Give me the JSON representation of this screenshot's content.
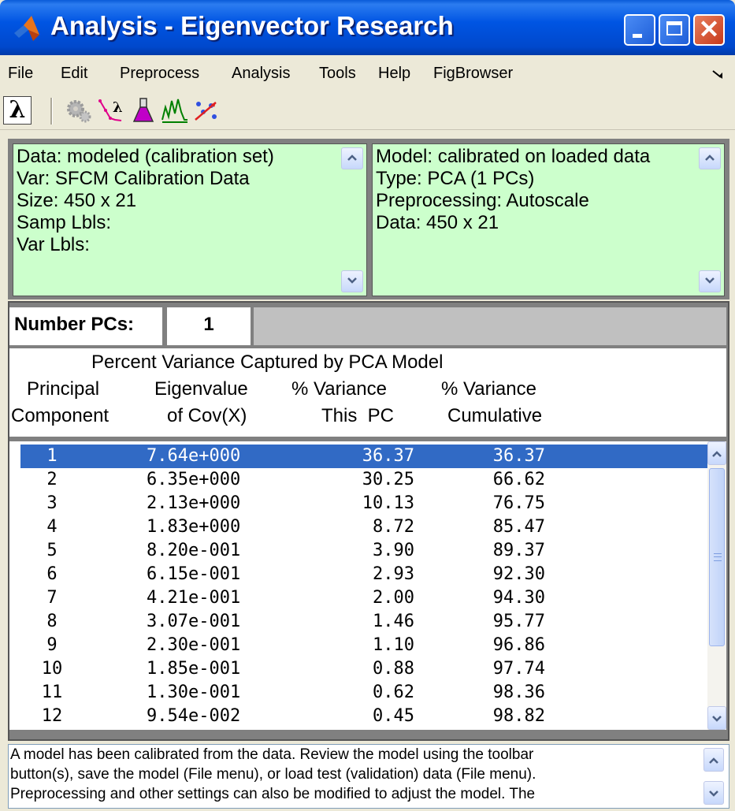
{
  "window": {
    "title": "Analysis - Eigenvector Research"
  },
  "menu": {
    "items": [
      "File",
      "Edit",
      "Preprocess",
      "Analysis",
      "Tools",
      "Help",
      "FigBrowser"
    ]
  },
  "toolbar": {
    "tools": [
      "lambda-icon",
      "gears-icon",
      "eigenvalue-plot-icon",
      "flask-icon",
      "spectrum-plot-icon",
      "scatter-arrow-icon"
    ]
  },
  "data_panel": {
    "lines": [
      "Data: modeled (calibration set)",
      "Var: SFCM Calibration Data",
      "Size: 450 x 21",
      "Samp Lbls:",
      "Var Lbls:"
    ]
  },
  "model_panel": {
    "lines": [
      "Model: calibrated on loaded data",
      "Type: PCA (1 PCs)",
      "Preprocessing: Autoscale",
      "Data: 450 x 21"
    ]
  },
  "pcs": {
    "label": "Number PCs:",
    "value": "1"
  },
  "table": {
    "title": "Percent Variance Captured by PCA Model",
    "headers": {
      "col1": [
        "Principal",
        "Component"
      ],
      "col2": [
        "Eigenvalue",
        "of Cov(X)"
      ],
      "col3": [
        "% Variance",
        "This  PC"
      ],
      "col4": [
        "% Variance",
        "Cumulative"
      ]
    },
    "rows": [
      [
        "1",
        "7.64e+000",
        "36.37",
        "36.37"
      ],
      [
        "2",
        "6.35e+000",
        "30.25",
        "66.62"
      ],
      [
        "3",
        "2.13e+000",
        "10.13",
        "76.75"
      ],
      [
        "4",
        "1.83e+000",
        "8.72",
        "85.47"
      ],
      [
        "5",
        "8.20e-001",
        "3.90",
        "89.37"
      ],
      [
        "6",
        "6.15e-001",
        "2.93",
        "92.30"
      ],
      [
        "7",
        "4.21e-001",
        "2.00",
        "94.30"
      ],
      [
        "8",
        "3.07e-001",
        "1.46",
        "95.77"
      ],
      [
        "9",
        "2.30e-001",
        "1.10",
        "96.86"
      ],
      [
        "10",
        "1.85e-001",
        "0.88",
        "97.74"
      ],
      [
        "11",
        "1.30e-001",
        "0.62",
        "98.36"
      ],
      [
        "12",
        "9.54e-002",
        "0.45",
        "98.82"
      ]
    ],
    "selected_index": 0
  },
  "status": {
    "lines": [
      "A model has been calibrated from the data. Review the model using the toolbar",
      "button(s), save the model (File menu), or load test (validation) data (File menu).",
      "Preprocessing and other settings can also be modified to adjust the model. The"
    ]
  },
  "colors": {
    "title_bar": "#0055e3",
    "panel_bg": "#ccffcc",
    "selection": "#316ac5"
  }
}
